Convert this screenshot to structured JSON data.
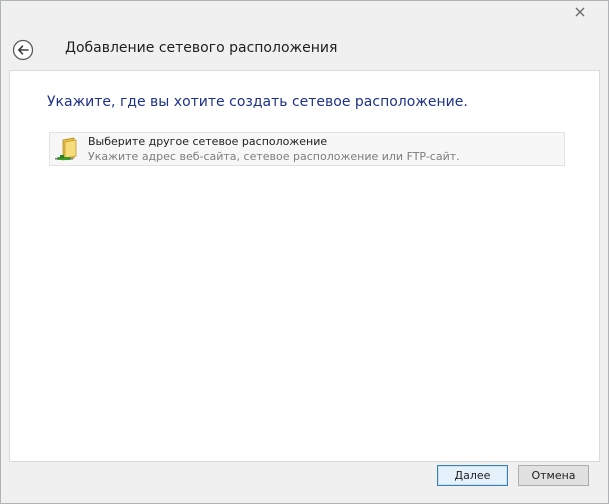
{
  "window": {
    "close_icon": "close-icon"
  },
  "header": {
    "back_icon": "back-arrow-icon",
    "title": "Добавление сетевого расположения"
  },
  "main": {
    "instruction": "Укажите, где вы хотите создать сетевое расположение.",
    "options": [
      {
        "icon": "network-folder-icon",
        "title": "Выберите другое сетевое расположение",
        "description": "Укажите адрес веб-сайта, сетевое расположение или FTP-сайт."
      }
    ]
  },
  "footer": {
    "next_label": "Далее",
    "cancel_label": "Отмена"
  },
  "colors": {
    "instruction_text": "#1e3287",
    "option_bg": "#f7f7f7",
    "primary_button_border": "#3c7fb1"
  }
}
